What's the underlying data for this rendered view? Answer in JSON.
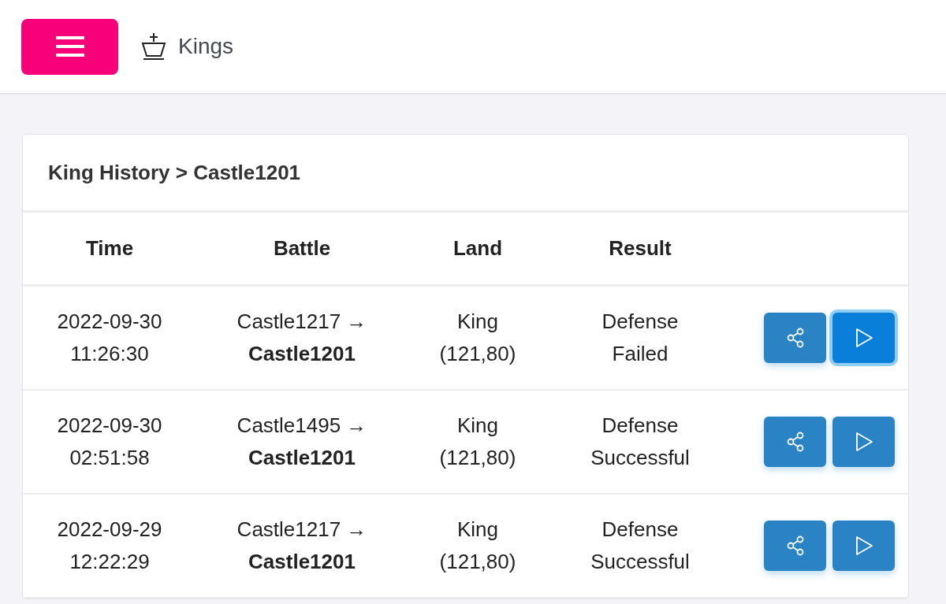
{
  "header": {
    "title": "Kings"
  },
  "card": {
    "title": "King History > Castle1201",
    "columns": [
      "Time",
      "Battle",
      "Land",
      "Result"
    ],
    "rows": [
      {
        "date": "2022-09-30",
        "time": "11:26:30",
        "from": "Castle1217 →",
        "to": "Castle1201",
        "land": "King",
        "coords": "(121,80)",
        "result": "Defense",
        "outcome": "Failed",
        "play_focused": true
      },
      {
        "date": "2022-09-30",
        "time": "02:51:58",
        "from": "Castle1495 →",
        "to": "Castle1201",
        "land": "King",
        "coords": "(121,80)",
        "result": "Defense",
        "outcome": "Successful",
        "play_focused": false
      },
      {
        "date": "2022-09-29",
        "time": "12:22:29",
        "from": "Castle1217 →",
        "to": "Castle1201",
        "land": "King",
        "coords": "(121,80)",
        "result": "Defense",
        "outcome": "Successful",
        "play_focused": false
      }
    ]
  }
}
